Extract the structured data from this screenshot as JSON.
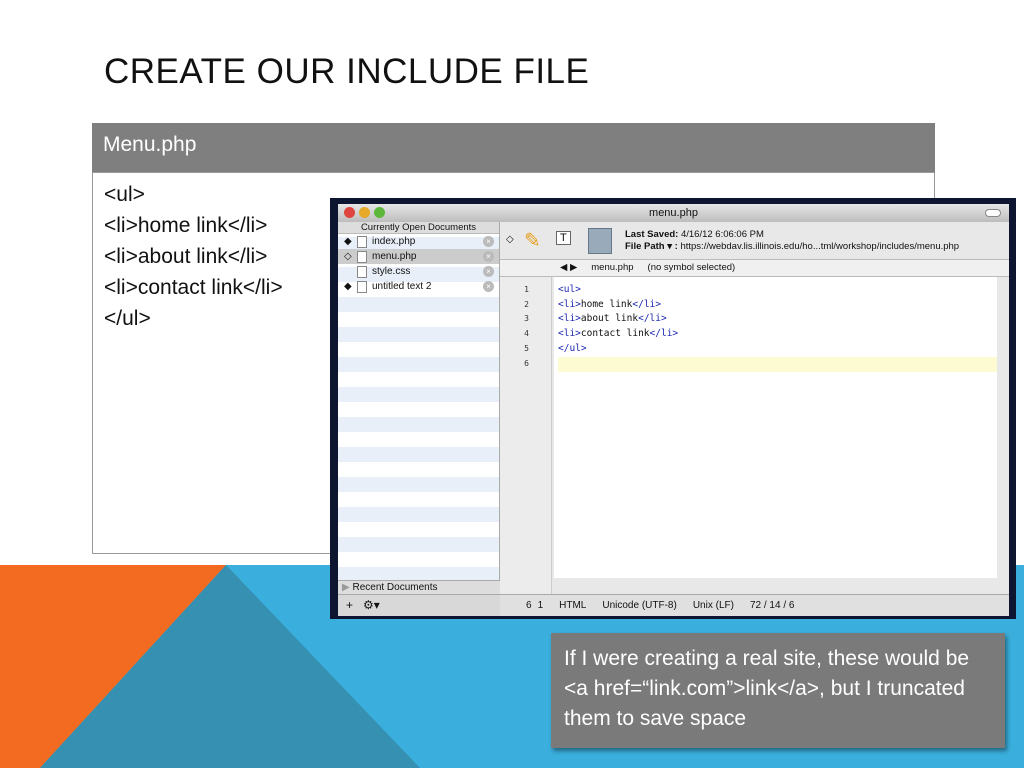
{
  "slide": {
    "title": "CREATE OUR INCLUDE FILE",
    "table_header": "Menu.php",
    "code_lines": [
      "<ul>",
      "<li>home link</li>",
      "<li>about link</li>",
      "<li>contact link</li>",
      "</ul>"
    ],
    "note": "If I were creating a real site, these would be <a href=“link.com”>link</a>, but I truncated them to save space"
  },
  "window": {
    "title": "menu.php",
    "sidebar_header": "Currently Open Documents",
    "documents": [
      {
        "name": "index.php",
        "marker": "◆"
      },
      {
        "name": "menu.php",
        "marker": "◇"
      },
      {
        "name": "style.css",
        "marker": ""
      },
      {
        "name": "untitled text 2",
        "marker": "◆"
      }
    ],
    "recent": "Recent Documents",
    "last_saved_label": "Last Saved:",
    "last_saved": "4/16/12 6:06:06 PM",
    "file_path_label": "File Path ▾ :",
    "file_path": "https://webdav.lis.illinois.edu/ho...tml/workshop/includes/menu.php",
    "nav_file": "menu.php",
    "nav_symbol": "(no symbol selected)",
    "line_numbers": [
      "1",
      "2",
      "3",
      "4",
      "5",
      "6"
    ],
    "code": [
      [
        "<ul>",
        ""
      ],
      [
        "<li>",
        "home link",
        "</li>"
      ],
      [
        "<li>",
        "about link",
        "</li>"
      ],
      [
        "<li>",
        "contact link",
        "</li>"
      ],
      [
        "</ul>"
      ]
    ],
    "status": {
      "line": "6",
      "col": "1",
      "syntax": "HTML",
      "encoding": "Unicode (UTF-8)",
      "line_endings": "Unix (LF)",
      "counts": "72 / 14 / 6"
    }
  },
  "colors": {
    "orange": "#f26b21",
    "blue": "#3aaedc",
    "teal": "#3590b2"
  }
}
